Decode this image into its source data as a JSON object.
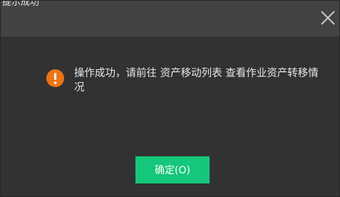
{
  "dialog": {
    "title": "提示成功",
    "message": "操作成功，请前往 资产移动列表 查看作业资产转移情况",
    "ok_label": "确定(O)",
    "icons": {
      "close": "close-icon",
      "warning": "warning-icon"
    },
    "colors": {
      "title_bar": "#434343",
      "body": "#323232",
      "warning": "#f0730f",
      "ok_button": "#15c77a",
      "text": "#e8e8e8"
    }
  }
}
